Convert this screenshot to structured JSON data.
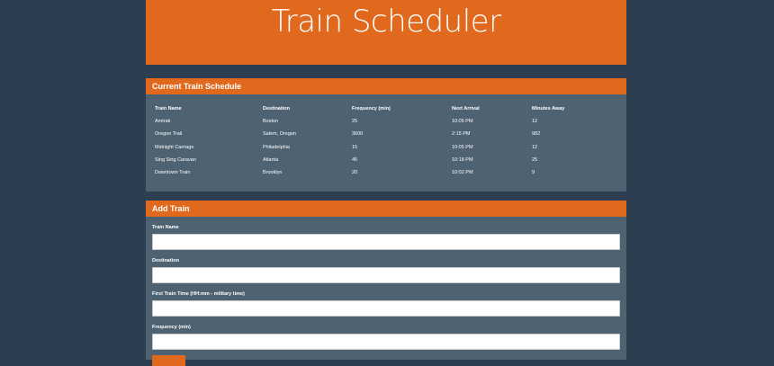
{
  "header": {
    "title": "Train Scheduler"
  },
  "schedule": {
    "heading": "Current Train Schedule",
    "columns": [
      "Train Name",
      "Destination",
      "Frequency (min)",
      "Next Arrival",
      "Minutes Away"
    ],
    "rows": [
      [
        "Amtrak",
        "Boston",
        "25",
        "10:05 PM",
        "12"
      ],
      [
        "Oregon Trail",
        "Salem, Oregon",
        "3600",
        "2:15 PM",
        "982"
      ],
      [
        "Midnight Carriage",
        "Philadelphia",
        "15",
        "10:05 PM",
        "12"
      ],
      [
        "Sing Sing Caravan",
        "Atlanta",
        "45",
        "10:18 PM",
        "25"
      ],
      [
        "Downtown Train",
        "Brooklyn",
        "20",
        "10:02 PM",
        "9"
      ]
    ]
  },
  "form": {
    "heading": "Add Train",
    "fields": {
      "train_name": {
        "label": "Train Name",
        "value": "",
        "placeholder": ""
      },
      "destination": {
        "label": "Destination",
        "value": "",
        "placeholder": ""
      },
      "first_train_time": {
        "label": "First Train Time (HH:mm - military time)",
        "value": "",
        "placeholder": ""
      },
      "frequency": {
        "label": "Frequency (min)",
        "value": "",
        "placeholder": ""
      }
    }
  },
  "colors": {
    "background": "#2c3e50",
    "accent": "#e0691e",
    "panel": "#4e6272"
  }
}
